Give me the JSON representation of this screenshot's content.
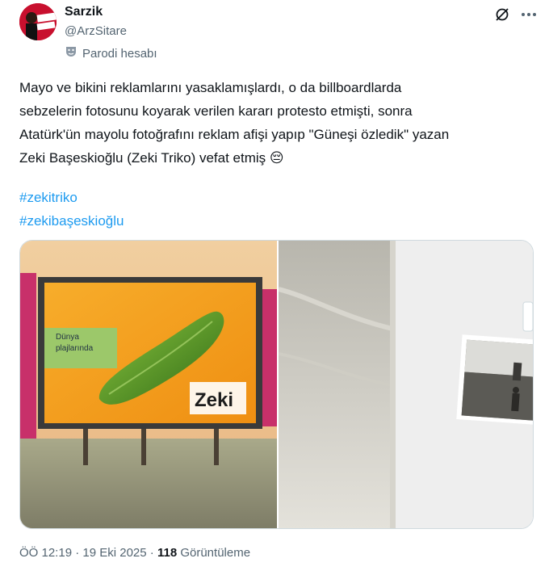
{
  "author": {
    "name": "Sarzik",
    "handle": "@ArzSitare",
    "label": "Parodi hesabı",
    "avatar_text": "ÖZGÜR\nLÜK!"
  },
  "tweet": {
    "text": "Mayo ve bikini reklamlarını yasaklamışlardı, o da billboardlarda\nsebzelerin fotosunu  koyarak verilen kararı protesto etmişti, sonra\nAtatürk'ün mayolu fotoğrafını reklam afişi yapıp \"Güneşi özledik\" yazan\nZeki Başeskioğlu (Zeki Triko) vefat etmiş 😔",
    "hashtags": [
      "#zekitriko",
      "#zekibaşeskioğlu"
    ]
  },
  "billboard": {
    "line1": "Dünya",
    "line2": "plajlarında",
    "brand": "Zeki"
  },
  "meta": {
    "time": "ÖÖ 12:19",
    "separator": " · ",
    "date": "19 Eki 2025",
    "separator2": " · ",
    "views": "118",
    "views_label": " Görüntüleme"
  },
  "colors": {
    "link": "#1d9bf0",
    "secondary": "#536471",
    "brand_red": "#c8102e"
  },
  "icons": [
    "grok-icon",
    "more-icon",
    "parody-mask-icon"
  ]
}
